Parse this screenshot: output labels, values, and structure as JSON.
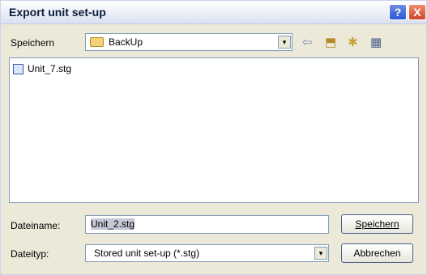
{
  "window": {
    "title": "Export unit set-up",
    "help_label": "?",
    "close_label": "X"
  },
  "save_in": {
    "label": "Speichern",
    "folder": "BackUp",
    "arrow": "▾"
  },
  "toolbar": {
    "back_glyph": "⇦",
    "up_glyph": "⬒",
    "new_folder_glyph": "✱",
    "views_glyph": "▦"
  },
  "files": [
    {
      "name": "Unit_7.stg"
    }
  ],
  "filename": {
    "label": "Dateiname:",
    "value": "Unit_2.stg"
  },
  "filetype": {
    "label": "Dateityp:",
    "value": "Stored unit set-up (*.stg)",
    "arrow": "▾"
  },
  "buttons": {
    "save": "Speichern",
    "cancel": "Abbrechen"
  }
}
